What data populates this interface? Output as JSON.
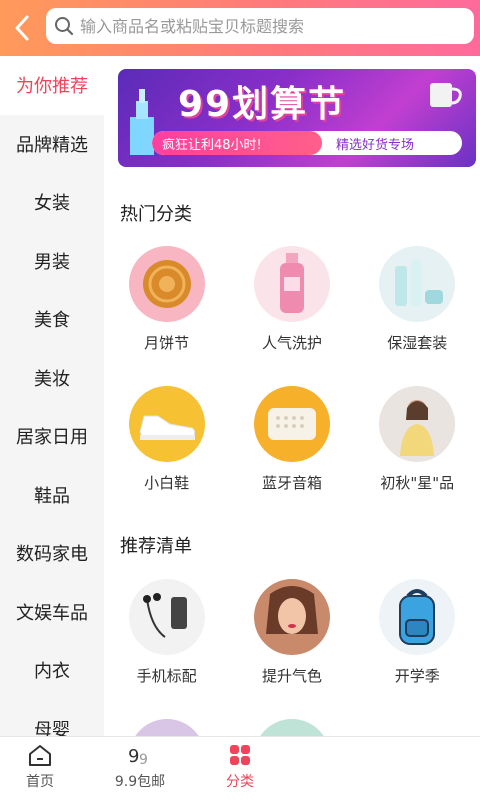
{
  "header": {
    "back_icon": "chevron-left-icon",
    "search_icon": "search-icon",
    "search_placeholder": "输入商品名或粘贴宝贝标题搜索"
  },
  "sidebar": {
    "items": [
      {
        "label": "为你推荐",
        "active": true
      },
      {
        "label": "品牌精选"
      },
      {
        "label": "女装"
      },
      {
        "label": "男装"
      },
      {
        "label": "美食"
      },
      {
        "label": "美妆"
      },
      {
        "label": "居家日用"
      },
      {
        "label": "鞋品"
      },
      {
        "label": "数码家电"
      },
      {
        "label": "文娱车品"
      },
      {
        "label": "内衣"
      },
      {
        "label": "母婴"
      }
    ]
  },
  "banner": {
    "title": "99划算节",
    "left_text": "疯狂让利48小时!",
    "right_text": "精选好货专场"
  },
  "hot": {
    "title": "热门分类",
    "items": [
      {
        "label": "月饼节"
      },
      {
        "label": "人气洗护"
      },
      {
        "label": "保湿套装"
      },
      {
        "label": "小白鞋"
      },
      {
        "label": "蓝牙音箱"
      },
      {
        "label": "初秋\"星\"品"
      }
    ]
  },
  "recommend": {
    "title": "推荐清单",
    "items": [
      {
        "label": "手机标配"
      },
      {
        "label": "提升气色"
      },
      {
        "label": "开学季"
      }
    ]
  },
  "bottom_nav": {
    "tabs": [
      {
        "label": "首页",
        "icon": "home-icon"
      },
      {
        "label": "9.9包邮",
        "icon": "nine-nine-icon"
      },
      {
        "label": "分类",
        "icon": "category-grid-icon",
        "active": true
      }
    ]
  },
  "colors": {
    "accent": "#f0445b",
    "header_gradient_start": "#ff9a5a",
    "header_gradient_end": "#ff6a9c"
  }
}
